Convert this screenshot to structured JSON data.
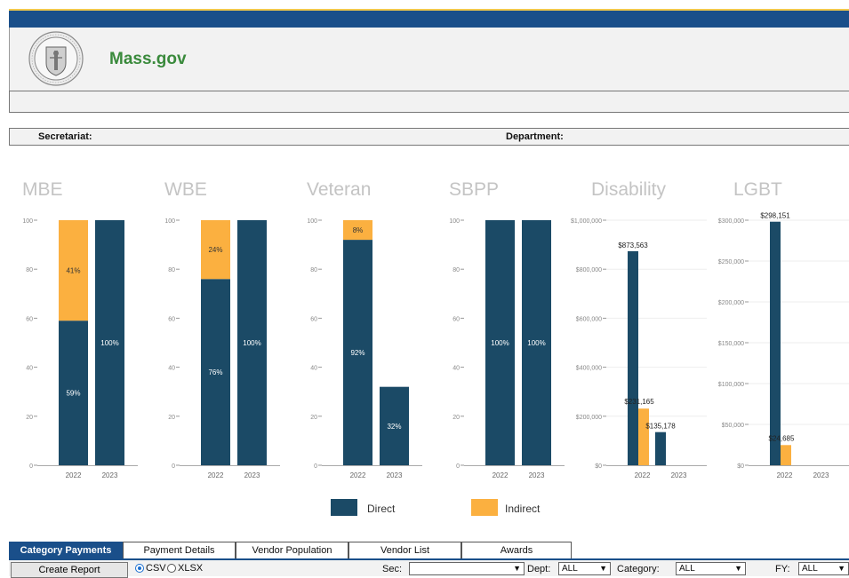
{
  "header": {
    "site_name": "Mass.gov"
  },
  "filters": {
    "secretariat_label": "Secretariat:",
    "department_label": "Department:"
  },
  "colors": {
    "direct": "#1b4a66",
    "indirect": "#fbb040",
    "brand": "#1a4f8a",
    "site_name": "#3a8a3c"
  },
  "chart_data": [
    {
      "type": "bar",
      "title": "MBE",
      "categories": [
        "2022",
        "2023"
      ],
      "ylim": [
        0,
        100
      ],
      "yticks": [
        "0",
        "20",
        "40",
        "60",
        "80",
        "100"
      ],
      "stacked": true,
      "series": [
        {
          "name": "Direct",
          "values": [
            59,
            100
          ],
          "labels": [
            "59%",
            "100%"
          ]
        },
        {
          "name": "Indirect",
          "values": [
            41,
            0
          ],
          "labels": [
            "41%",
            ""
          ]
        }
      ]
    },
    {
      "type": "bar",
      "title": "WBE",
      "categories": [
        "2022",
        "2023"
      ],
      "ylim": [
        0,
        100
      ],
      "yticks": [
        "0",
        "20",
        "40",
        "60",
        "80",
        "100"
      ],
      "stacked": true,
      "series": [
        {
          "name": "Direct",
          "values": [
            76,
            100
          ],
          "labels": [
            "76%",
            "100%"
          ]
        },
        {
          "name": "Indirect",
          "values": [
            24,
            0
          ],
          "labels": [
            "24%",
            ""
          ]
        }
      ]
    },
    {
      "type": "bar",
      "title": "Veteran",
      "categories": [
        "2022",
        "2023"
      ],
      "ylim": [
        0,
        100
      ],
      "yticks": [
        "0",
        "20",
        "40",
        "60",
        "80",
        "100"
      ],
      "stacked": true,
      "series": [
        {
          "name": "Direct",
          "values": [
            92,
            32
          ],
          "labels": [
            "92%",
            "32%"
          ]
        },
        {
          "name": "Indirect",
          "values": [
            8,
            0
          ],
          "labels": [
            "8%",
            ""
          ]
        }
      ]
    },
    {
      "type": "bar",
      "title": "SBPP",
      "categories": [
        "2022",
        "2023"
      ],
      "ylim": [
        0,
        100
      ],
      "yticks": [
        "0",
        "20",
        "40",
        "60",
        "80",
        "100"
      ],
      "stacked": true,
      "series": [
        {
          "name": "Direct",
          "values": [
            100,
            100
          ],
          "labels": [
            "100%",
            "100%"
          ]
        },
        {
          "name": "Indirect",
          "values": [
            0,
            0
          ],
          "labels": [
            "",
            ""
          ]
        }
      ]
    },
    {
      "type": "bar",
      "title": "Disability",
      "categories": [
        "2022",
        "2023"
      ],
      "ylim": [
        0,
        1000000
      ],
      "yticks": [
        "$0",
        "$200,000",
        "$400,000",
        "$600,000",
        "$800,000",
        "$1,000,000"
      ],
      "stacked": false,
      "series": [
        {
          "name": "Direct",
          "values": [
            873563,
            135178
          ],
          "labels": [
            "$873,563",
            "$135,178"
          ]
        },
        {
          "name": "Indirect",
          "values": [
            231165,
            0
          ],
          "labels": [
            "$231,165",
            ""
          ]
        }
      ]
    },
    {
      "type": "bar",
      "title": "LGBT",
      "categories": [
        "2022",
        "2023"
      ],
      "ylim": [
        0,
        300000
      ],
      "yticks": [
        "$0",
        "$50,000",
        "$100,000",
        "$150,000",
        "$200,000",
        "$250,000",
        "$300,000"
      ],
      "stacked": false,
      "series": [
        {
          "name": "Direct",
          "values": [
            298151,
            0
          ],
          "labels": [
            "$298,151",
            ""
          ]
        },
        {
          "name": "Indirect",
          "values": [
            24685,
            0
          ],
          "labels": [
            "$24,685",
            ""
          ]
        }
      ]
    }
  ],
  "legend": {
    "direct": "Direct",
    "indirect": "Indirect"
  },
  "tabs": [
    {
      "label": "Category Payments",
      "active": true
    },
    {
      "label": "Payment Details",
      "active": false
    },
    {
      "label": "Vendor Population",
      "active": false
    },
    {
      "label": "Vendor List",
      "active": false
    },
    {
      "label": "Awards",
      "active": false
    }
  ],
  "toolbar": {
    "create_report_label": "Create Report",
    "format_csv": "CSV",
    "format_xlsx": "XLSX",
    "format_selected": "CSV",
    "sec_label": "Sec:",
    "sec_value": "",
    "dept_label": "Dept:",
    "dept_value": "ALL",
    "category_label": "Category:",
    "category_value": "ALL",
    "fy_label": "FY:",
    "fy_value": "ALL"
  }
}
